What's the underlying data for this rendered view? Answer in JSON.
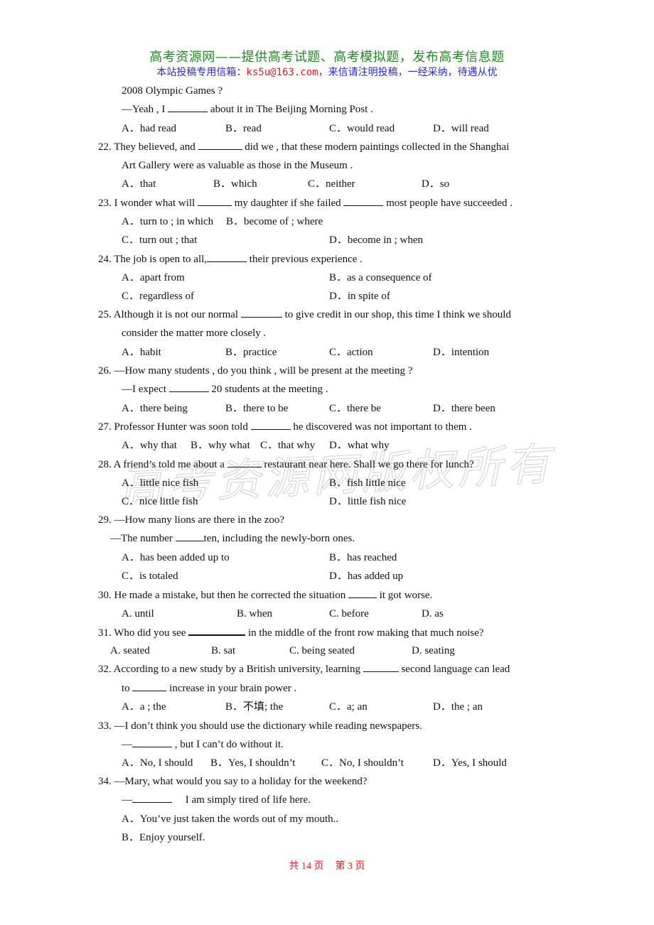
{
  "header": {
    "title": "高考资源网——提供高考试题、高考模拟题，发布高考信息题",
    "submission_prefix": "本站投稿专用信箱：",
    "email": "ks5u@163.com",
    "submission_suffix": "，来信请注明投稿，一经采纳，待遇从优"
  },
  "watermark": "高考资源网版权所有",
  "q21": {
    "cont": "2008 Olympic Games ?",
    "reply_pre": "—Yeah , I",
    "reply_post": "about it in The Beijing Morning Post .",
    "options": [
      "A．had read",
      "B．read",
      "C．would read",
      "D．will read"
    ]
  },
  "q22": {
    "pre": "22. They believed, and",
    "post": "did we , that these modern paintings collected in the Shanghai",
    "cont": "Art Gallery were as valuable as those in the Museum .",
    "options": [
      "A．that",
      "B．which",
      "C．neither",
      "D．so"
    ]
  },
  "q23": {
    "pre": "23. I wonder what will",
    "mid": "my daughter if she failed",
    "post": "most people have succeeded .",
    "options": [
      "A．turn to ; in which",
      "B．become of ; where",
      "C．turn out ; that",
      "D．become in ; when"
    ]
  },
  "q24": {
    "pre": "24. The job is open to all,",
    "post": "their previous experience .",
    "options": [
      "A．apart from",
      "B．as a consequence of",
      "C．regardless of",
      "D．in spite of"
    ]
  },
  "q25": {
    "pre": "25. Although it is not our normal",
    "post": "to give credit in our shop, this time I think we should",
    "cont": "consider the matter more closely .",
    "options": [
      "A．habit",
      "B．practice",
      "C．action",
      "D．intention"
    ]
  },
  "q26": {
    "text": "26. —How many students , do you think , will be present at the meeting ?",
    "reply_pre": "—I expect",
    "reply_post": "20 students at the meeting .",
    "options": [
      "A．there being",
      "B．there to be",
      "C．there be",
      "D．there been"
    ]
  },
  "q27": {
    "pre": "27. Professor Hunter was soon told",
    "post": "he discovered was not important to them .",
    "options": [
      "A．why that",
      "B．why what",
      "C．that why",
      "D．what why"
    ]
  },
  "q28": {
    "pre": "28. A friend’s told me about a",
    "post": "restaurant near here. Shall we go there for lunch?",
    "options": [
      "A．little nice fish",
      "B．fish little nice",
      "C．nice little fish",
      "D．little fish nice"
    ]
  },
  "q29": {
    "text": "29. —How many lions are there in the zoo?",
    "reply_pre": "—The number",
    "reply_post": "ten, including the newly-born ones.",
    "options": [
      "A．has been added up to",
      "B．has reached",
      "C．is totaled",
      "D．has added up"
    ]
  },
  "q30": {
    "pre": "30. He made a mistake, but then he corrected the situation",
    "post": "it got worse.",
    "options": [
      "A. until",
      "B. when",
      "C. before",
      "D. as"
    ]
  },
  "q31": {
    "pre": "31. Who did you see",
    "post": "in the middle of the front row making that much noise?",
    "options": [
      "A. seated",
      "B. sat",
      "C. being seated",
      "D. seating"
    ]
  },
  "q32": {
    "pre": "32. According to a new study by a British university, learning",
    "post": "second language can lead",
    "cont_pre": "to",
    "cont_post": "increase in your brain power .",
    "options": [
      "A．a ; the",
      "B．不填; the",
      "C．a; an",
      "D．the ; an"
    ]
  },
  "q33": {
    "text": "33. —I don’t think you should use the dictionary while reading newspapers.",
    "reply_pre": "—",
    "reply_post": ", but I can’t do without it.",
    "options": [
      "A．No, I should",
      "B．Yes, I shouldn’t",
      "C．No, I shouldn’t",
      "D．Yes, I should"
    ]
  },
  "q34": {
    "text": "34. —Mary, what would you say to a holiday for the weekend?",
    "reply_pre": "—",
    "reply_post": "I am simply tired of life here.",
    "options": [
      "A．You’ve just taken the words out of my mouth..",
      "B．Enjoy yourself."
    ]
  },
  "footer": {
    "total_pages": "共 14 页",
    "current_page": "第 3 页"
  }
}
